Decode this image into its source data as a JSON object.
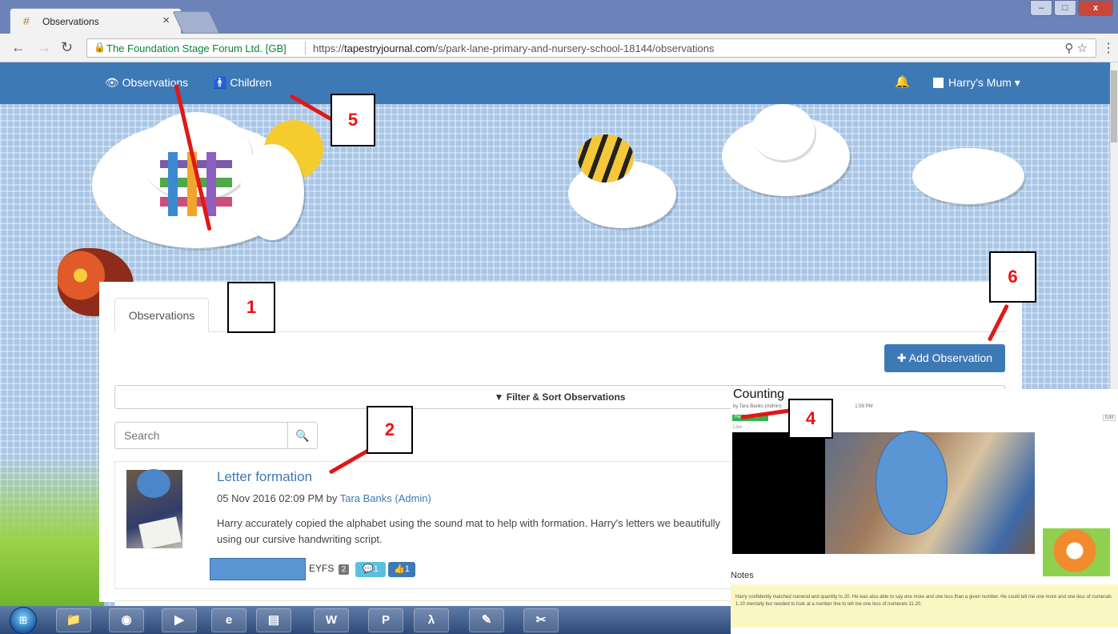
{
  "browser": {
    "tab_title": "Observations",
    "tab_close": "×",
    "cert_name": "The Foundation Stage Forum Ltd. [GB]",
    "url_prefix": "https://",
    "url_domain": "tapestryjournal.com",
    "url_path": "/s/park-lane-primary-and-nursery-school-18144/observations",
    "window_controls": [
      "–",
      "□",
      "x"
    ]
  },
  "nav": {
    "observations": "Observations",
    "children": "Children",
    "user": "Harry's Mum"
  },
  "main": {
    "tab_label": "Observations",
    "add_button": "Add Observation",
    "filter_label": "Filter & Sort Observations",
    "search_placeholder": "Search"
  },
  "observation": {
    "title": "Letter formation",
    "date": "05 Nov 2016 02:09 PM by",
    "author": "Tara Banks (Admin)",
    "text": "Harry accurately copied the alphabet using the sound mat to help with formation. Harry's letters we beautifully using our cursive handwriting script.",
    "framework": "EYFS",
    "framework_count": "2",
    "comments": "1",
    "likes": "1"
  },
  "detail": {
    "title": "Counting",
    "by": "by Tara Banks (Admin)",
    "time": "1:59 PM",
    "child_chip": "Harry Pottner",
    "like": "Like",
    "edit": "Edit",
    "notes_label": "Notes",
    "notes_text": "Harry confidently matched numeral and quantity to 20. He was also able to say one more and one less than a given number. He could tell me one more and one less of numerals 1-10 mentally but needed to look at a number line to tell me one less of numerals 11-20."
  },
  "callouts": [
    "1",
    "2",
    "4",
    "5",
    "6"
  ],
  "colors": {
    "brand": "#3d79b5",
    "annotation": "#e41616"
  }
}
